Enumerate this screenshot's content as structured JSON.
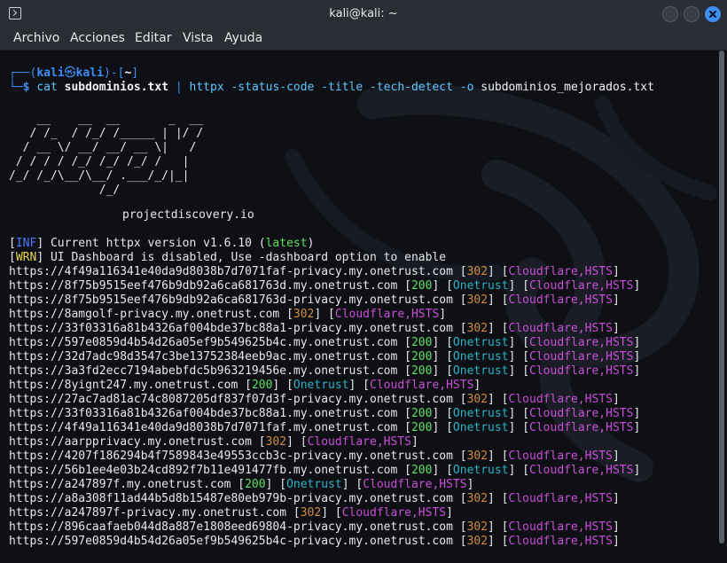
{
  "window": {
    "title": "kali@kali: ~"
  },
  "menu": [
    "Archivo",
    "Acciones",
    "Editar",
    "Vista",
    "Ayuda"
  ],
  "prompt": {
    "line1_prefix": "┌──(",
    "user": "kali",
    "at_symbol": "㉿",
    "host": "kali",
    "line1_mid": ")-[",
    "path": "~",
    "line1_suffix": "]",
    "line2_prefix": "└─",
    "dollar": "$",
    "cmd_cat": "cat",
    "cmd_file": "subdominios.txt",
    "cmd_pipe": "|",
    "cmd_tool": "httpx",
    "cmd_args": "-status-code -title -tech-detect -o",
    "cmd_out": "subdominios_mejorados.txt"
  },
  "logo_lines": [
    "    __    __  __       _  __",
    "   / /_  / /_/ /_____ | |/ /",
    "  / __ \\/ __/ __/ __ \\|   / ",
    " / / / / /_/ /_/ /_/ /   |  ",
    "/_/ /_/\\__/\\__/ .___/_/|_|  ",
    "             /_/            "
  ],
  "logo_site": "projectdiscovery.io",
  "info_lines": {
    "inf_tag": "INF",
    "inf_text_before": " Current httpx version v1.6.10 (",
    "inf_latest": "latest",
    "inf_text_after": ")",
    "wrn_tag": "WRN",
    "wrn_text": " UI Dashboard is disabled, Use -dashboard option to enable"
  },
  "results": [
    {
      "url": "https://4f49a116341e40da9d8038b7d7071faf-privacy.my.onetrust.com",
      "status": "302",
      "title": "",
      "tech": "Cloudflare,HSTS"
    },
    {
      "url": "https://8f75b9515eef476b9db92a6ca681763d.my.onetrust.com",
      "status": "200",
      "title": "Onetrust",
      "tech": "Cloudflare,HSTS"
    },
    {
      "url": "https://8f75b9515eef476b9db92a6ca681763d-privacy.my.onetrust.com",
      "status": "302",
      "title": "",
      "tech": "Cloudflare,HSTS"
    },
    {
      "url": "https://8amgolf-privacy.my.onetrust.com",
      "status": "302",
      "title": "",
      "tech": "Cloudflare,HSTS"
    },
    {
      "url": "https://33f03316a81b4326af004bde37bc88a1-privacy.my.onetrust.com",
      "status": "302",
      "title": "",
      "tech": "Cloudflare,HSTS"
    },
    {
      "url": "https://597e0859d4b54d26a05ef9b549625b4c.my.onetrust.com",
      "status": "200",
      "title": "Onetrust",
      "tech": "Cloudflare,HSTS"
    },
    {
      "url": "https://32d7adc98d3547c3be13752384eeb9ac.my.onetrust.com",
      "status": "200",
      "title": "Onetrust",
      "tech": "Cloudflare,HSTS"
    },
    {
      "url": "https://3a3fd2ecc7194abebfdc5b963219456e.my.onetrust.com",
      "status": "200",
      "title": "Onetrust",
      "tech": "Cloudflare,HSTS"
    },
    {
      "url": "https://8yignt247.my.onetrust.com",
      "status": "200",
      "title": "Onetrust",
      "tech": "Cloudflare,HSTS"
    },
    {
      "url": "https://27ac7ad81ac74c8087205df837f07d3f-privacy.my.onetrust.com",
      "status": "302",
      "title": "",
      "tech": "Cloudflare,HSTS"
    },
    {
      "url": "https://33f03316a81b4326af004bde37bc88a1.my.onetrust.com",
      "status": "200",
      "title": "Onetrust",
      "tech": "Cloudflare,HSTS"
    },
    {
      "url": "https://4f49a116341e40da9d8038b7d7071faf.my.onetrust.com",
      "status": "200",
      "title": "Onetrust",
      "tech": "Cloudflare,HSTS"
    },
    {
      "url": "https://aarpprivacy.my.onetrust.com",
      "status": "302",
      "title": "",
      "tech": "Cloudflare,HSTS"
    },
    {
      "url": "https://4207f186294b4f7589843e49553ccb3c-privacy.my.onetrust.com",
      "status": "302",
      "title": "",
      "tech": "Cloudflare,HSTS"
    },
    {
      "url": "https://56b1ee4e03b24cd892f7b11e491477fb.my.onetrust.com",
      "status": "200",
      "title": "Onetrust",
      "tech": "Cloudflare,HSTS"
    },
    {
      "url": "https://a247897f.my.onetrust.com",
      "status": "200",
      "title": "Onetrust",
      "tech": "Cloudflare,HSTS"
    },
    {
      "url": "https://a8a308f11ad44b5d8b15487e80eb979b-privacy.my.onetrust.com",
      "status": "302",
      "title": "",
      "tech": "Cloudflare,HSTS"
    },
    {
      "url": "https://a247897f-privacy.my.onetrust.com",
      "status": "302",
      "title": "",
      "tech": "Cloudflare,HSTS"
    },
    {
      "url": "https://896caafaeb044d8a887e1808eed69804-privacy.my.onetrust.com",
      "status": "302",
      "title": "",
      "tech": "Cloudflare,HSTS"
    },
    {
      "url": "https://597e0859d4b54d26a05ef9b549625b4c-privacy.my.onetrust.com",
      "status": "302",
      "title": "",
      "tech": "Cloudflare,HSTS"
    }
  ],
  "colors": {
    "status": "#2fb3c4",
    "status_302": "#d18d3e",
    "status_200": "#5ce05c",
    "title": "#2fb3c4",
    "tech": "#c94fd6",
    "prompt": "#3d8ef0"
  }
}
